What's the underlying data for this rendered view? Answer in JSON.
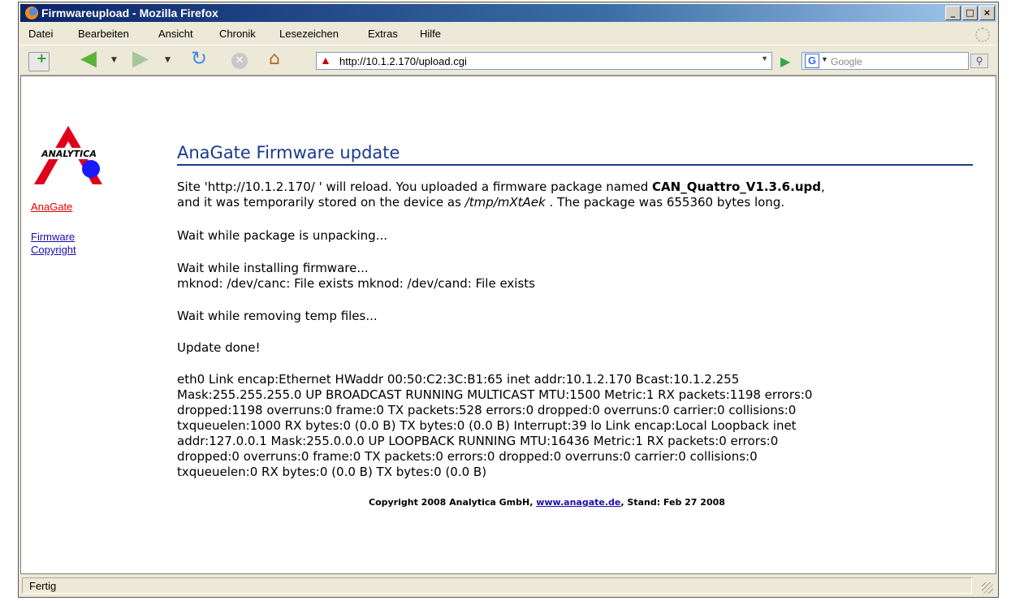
{
  "window": {
    "title": "Firmwareupload - Mozilla Firefox",
    "min": "_",
    "max": "□",
    "close": "×"
  },
  "menu": [
    "Datei",
    "Bearbeiten",
    "Ansicht",
    "Chronik",
    "Lesezeichen",
    "Extras",
    "Hilfe"
  ],
  "toolbar": {
    "url": "http://10.1.2.170/upload.cgi",
    "search_placeholder": "Google",
    "search_engine_letter": "G",
    "icons": [
      "new-tab-icon",
      "back-arrow-icon",
      "forward-arrow-icon",
      "reload-icon",
      "stop-icon",
      "home-icon",
      "go-icon",
      "search-icon"
    ]
  },
  "page": {
    "logo_text": "ANALYTICA",
    "nav": {
      "anagate": "AnaGate",
      "firmware": "Firmware",
      "copyright": "Copyright"
    },
    "heading": "AnaGate Firmware update",
    "intro": {
      "p1": "Site 'http://10.1.2.170/ ' will reload. You uploaded a firmware package named ",
      "filename": "CAN_Quattro_V1.3.6.upd",
      "p2": ",",
      "p3": "and it was temporarily stored on the device as ",
      "tmp": "/tmp/mXtAek",
      "p4": " . The package was 655360 bytes long."
    },
    "step1": "Wait while package is unpacking...",
    "step2a": "Wait while installing firmware...",
    "step2b": "mknod: /dev/canc: File exists mknod: /dev/cand: File exists",
    "step3": "Wait while removing temp files...",
    "step4": "Update done!",
    "ifconfig": [
      "eth0 Link encap:Ethernet HWaddr 00:50:C2:3C:B1:65 inet addr:10.1.2.170 Bcast:10.1.2.255",
      "Mask:255.255.255.0 UP BROADCAST RUNNING MULTICAST MTU:1500 Metric:1 RX packets:1198 errors:0",
      "dropped:1198 overruns:0 frame:0 TX packets:528 errors:0 dropped:0 overruns:0 carrier:0 collisions:0",
      "txqueuelen:1000 RX bytes:0 (0.0 B) TX bytes:0 (0.0 B) Interrupt:39 lo Link encap:Local Loopback inet",
      "addr:127.0.0.1 Mask:255.0.0.0 UP LOOPBACK RUNNING MTU:16436 Metric:1 RX packets:0 errors:0",
      "dropped:0 overruns:0 frame:0 TX packets:0 errors:0 dropped:0 overruns:0 carrier:0 collisions:0",
      "txqueuelen:0 RX bytes:0 (0.0 B) TX bytes:0 (0.0 B)"
    ],
    "footer": {
      "pre": "Copyright 2008 Analytica GmbH, ",
      "link": "www.anagate.de",
      "post": ", Stand: Feb 27 2008"
    }
  },
  "status": "Fertig",
  "colors": {
    "heading": "#1a3a8a",
    "nav_active": "#e00000",
    "link": "#1a0dab",
    "logo_red": "#e0001a",
    "logo_blue": "#1a1aff"
  }
}
